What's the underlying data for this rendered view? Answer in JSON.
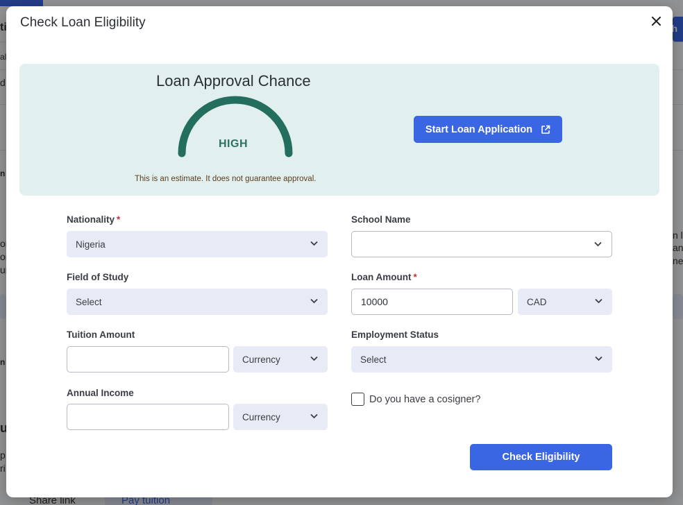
{
  "background": {
    "fragments": [
      "ti",
      "ali",
      "d",
      "n",
      "on",
      "on",
      "ur",
      "n",
      "ui",
      "p",
      "ri",
      "n li",
      "an",
      "ne",
      "ith"
    ],
    "share_link": "Share link",
    "pay_tuition": "Pay tuition"
  },
  "modal": {
    "title": "Check Loan Eligibility",
    "close_icon": "close-icon"
  },
  "approval": {
    "heading": "Loan Approval Chance",
    "level": "HIGH",
    "level_fraction": 1.0,
    "disclaimer": "This is an estimate. It does not guarantee approval.",
    "start_button": "Start Loan Application",
    "start_icon": "external-link-icon"
  },
  "form": {
    "nationality": {
      "label": "Nationality",
      "required": "*",
      "value": "Nigeria"
    },
    "school_name": {
      "label": "School Name",
      "value": ""
    },
    "field_of_study": {
      "label": "Field of Study",
      "value": "Select"
    },
    "loan_amount": {
      "label": "Loan Amount",
      "required": "*",
      "value": "10000",
      "currency": "CAD"
    },
    "tuition_amount": {
      "label": "Tuition Amount",
      "value": "",
      "currency": "Currency"
    },
    "employment_status": {
      "label": "Employment Status",
      "value": "Select"
    },
    "annual_income": {
      "label": "Annual Income",
      "value": "",
      "currency": "Currency"
    },
    "cosigner": {
      "label": "Do you have a cosigner?",
      "checked": false
    },
    "submit": "Check Eligibility"
  },
  "colors": {
    "primary": "#3b66e3",
    "panel_bg": "#e1f0ee",
    "gauge": "#246e5e",
    "required": "#c2323e"
  }
}
